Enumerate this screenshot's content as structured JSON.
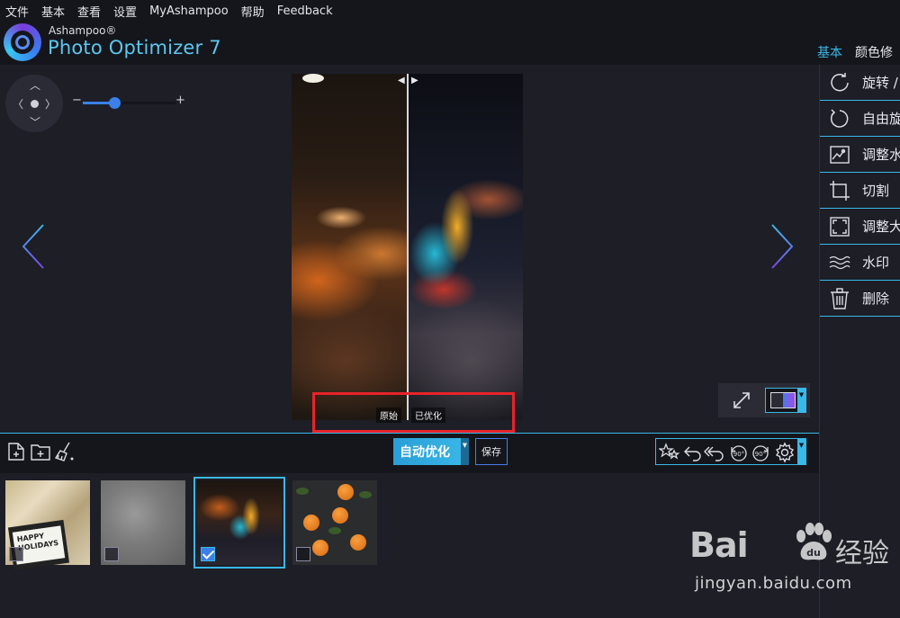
{
  "menu": [
    "文件",
    "基本",
    "查看",
    "设置",
    "MyAshampoo",
    "帮助",
    "Feedback"
  ],
  "brand": {
    "small": "Ashampoo®",
    "big": "Photo Optimizer 7"
  },
  "tabs": [
    {
      "label": "基本",
      "active": true
    },
    {
      "label": "颜色修",
      "active": false
    }
  ],
  "zoom": {
    "minus": "−",
    "plus": "+",
    "level_fraction": 0.34
  },
  "compare": {
    "original_label": "原始",
    "optimized_label": "已优化"
  },
  "toolbar": {
    "auto_optimize": "自动优化",
    "save": "保存"
  },
  "side_panel": {
    "items": [
      {
        "label": "旋转 /",
        "icon": "rotate-icon"
      },
      {
        "label": "自由旋",
        "icon": "free-rotate-icon"
      },
      {
        "label": "调整水",
        "icon": "straighten-icon"
      },
      {
        "label": "切割",
        "icon": "crop-icon"
      },
      {
        "label": "调整大",
        "icon": "resize-icon"
      },
      {
        "label": "水印",
        "icon": "watermark-icon"
      },
      {
        "label": "删除",
        "icon": "trash-icon"
      }
    ]
  },
  "thumbnails": [
    {
      "name": "happy-holidays",
      "card_text": "HAPPY HOLIDAYS",
      "checked": false,
      "selected": false
    },
    {
      "name": "concrete",
      "checked": false,
      "selected": false
    },
    {
      "name": "street-lights",
      "checked": true,
      "selected": true
    },
    {
      "name": "oranges",
      "checked": false,
      "selected": false
    }
  ],
  "watermark": {
    "logo_text": "Bai",
    "text_cn": "经验",
    "url": "jingyan.baidu.com"
  },
  "colors": {
    "accent": "#3ab8e8",
    "background": "#1d1e26",
    "highlight_box": "#e8232a"
  }
}
